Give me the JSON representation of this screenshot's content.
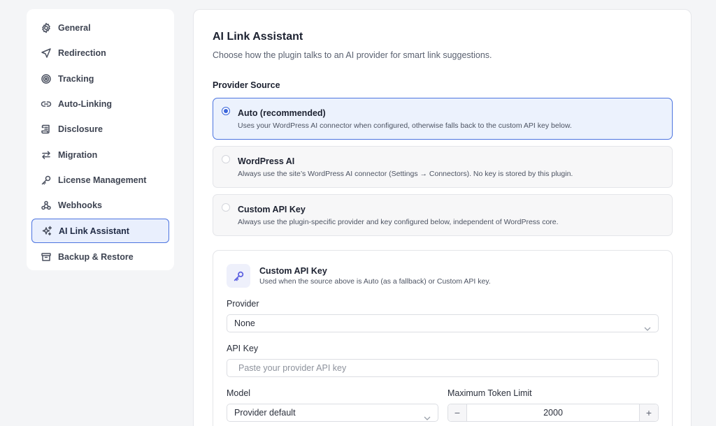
{
  "sidebar": {
    "items": [
      {
        "label": "General",
        "icon": "gear-icon"
      },
      {
        "label": "Redirection",
        "icon": "navigation-arrow-icon"
      },
      {
        "label": "Tracking",
        "icon": "target-icon"
      },
      {
        "label": "Auto-Linking",
        "icon": "link-icon"
      },
      {
        "label": "Disclosure",
        "icon": "scroll-icon"
      },
      {
        "label": "Migration",
        "icon": "arrows-swap-icon"
      },
      {
        "label": "License Management",
        "icon": "key-icon"
      },
      {
        "label": "Webhooks",
        "icon": "webhook-icon"
      },
      {
        "label": "AI Link Assistant",
        "icon": "sparkles-icon",
        "active": true
      },
      {
        "label": "Backup & Restore",
        "icon": "archive-icon"
      }
    ]
  },
  "main": {
    "title": "AI Link Assistant",
    "subtitle": "Choose how the plugin talks to an AI provider for smart link suggestions.",
    "provider_source_label": "Provider Source",
    "options": [
      {
        "title": "Auto (recommended)",
        "desc": "Uses your WordPress AI connector when configured, otherwise falls back to the custom API key below.",
        "selected": true
      },
      {
        "title": "WordPress AI",
        "desc": "Always use the site’s WordPress AI connector (Settings → Connectors). No key is stored by this plugin.",
        "selected": false
      },
      {
        "title": "Custom API Key",
        "desc": "Always use the plugin-specific provider and key configured below, independent of WordPress core.",
        "selected": false
      }
    ],
    "custom_card": {
      "title": "Custom API Key",
      "desc": "Used when the source above is Auto (as a fallback) or Custom API key.",
      "provider_label": "Provider",
      "provider_value": "None",
      "api_key_label": "API Key",
      "api_key_placeholder": "Paste your provider API key",
      "api_key_value": "",
      "model_label": "Model",
      "model_value": "Provider default",
      "token_label": "Maximum Token Limit",
      "token_value": "2000",
      "token_minus": "−",
      "token_plus": "+"
    }
  },
  "colors": {
    "accent": "#3b66db",
    "active_bg": "#e9effd",
    "background": "#f4f5f7"
  }
}
